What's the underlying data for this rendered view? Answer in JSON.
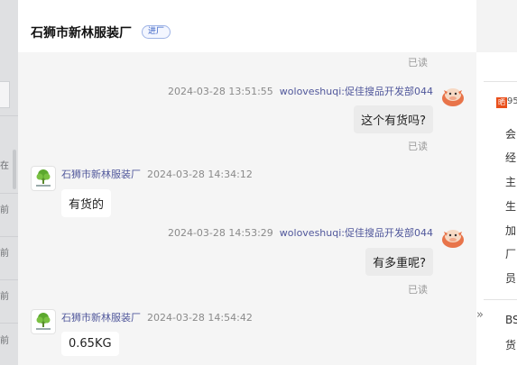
{
  "header": {
    "shop_name": "石狮市新林服装厂",
    "badge": "进厂"
  },
  "messages": {
    "top_read": "已读",
    "m1": {
      "time": "2024-03-28 13:51:55",
      "sender": "woloveshuqi:促佳搜品开发部044",
      "text": "这个有货吗?",
      "read": "已读"
    },
    "m2": {
      "sender": "石狮市新林服装厂",
      "time": "2024-03-28 14:34:12",
      "text": "有货的"
    },
    "m3": {
      "time": "2024-03-28 14:53:29",
      "sender": "woloveshuqi:促佳搜品开发部044",
      "text": "有多重呢?",
      "read": "已读"
    },
    "m4": {
      "sender": "石狮市新林服装厂",
      "time": "2024-03-28 14:54:42",
      "text": "0.65KG"
    }
  },
  "left_list": {
    "items": [
      "在",
      "前",
      "前",
      "前",
      "前"
    ]
  },
  "right_panel": {
    "tag": "晒",
    "tag_text": "95",
    "chars": [
      "会",
      "经",
      "主",
      "生",
      "加",
      "厂",
      "员"
    ],
    "chevron": "»",
    "bottom": [
      "BS",
      "货"
    ]
  },
  "colors": {
    "accent": "#3a62c4",
    "sender": "#50579b",
    "tag": "#e94f1b"
  }
}
